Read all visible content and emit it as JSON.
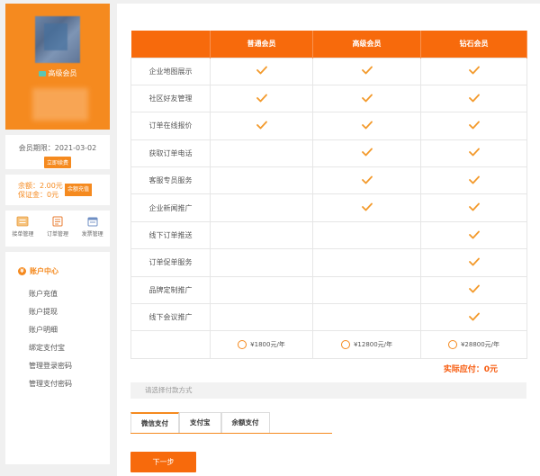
{
  "profile": {
    "level_label": "高级会员",
    "expire_text": "会员期限：2021-03-02",
    "renew_button": "立即续费"
  },
  "balance": {
    "balance_text": "余额：2.00元",
    "deposit_text": "保证金：0元",
    "recharge_button": "余额充值"
  },
  "shortcuts": [
    {
      "label": "接单管理",
      "icon": "clipboard-icon"
    },
    {
      "label": "订单管理",
      "icon": "order-icon"
    },
    {
      "label": "发票管理",
      "icon": "invoice-icon"
    }
  ],
  "account": {
    "title": "账户中心",
    "title_icon": "¥",
    "items": [
      "账户充值",
      "账户提现",
      "账户明细",
      "绑定支付宝",
      "管理登录密码",
      "管理支付密码"
    ]
  },
  "table": {
    "headers": [
      "",
      "普通会员",
      "高级会员",
      "钻石会员"
    ],
    "rows": [
      {
        "feature": "企业地图展示",
        "checks": [
          true,
          true,
          true
        ]
      },
      {
        "feature": "社区好友管理",
        "checks": [
          true,
          true,
          true
        ]
      },
      {
        "feature": "订单在线报价",
        "checks": [
          true,
          true,
          true
        ]
      },
      {
        "feature": "获取订单电话",
        "checks": [
          false,
          true,
          true
        ]
      },
      {
        "feature": "客服专员服务",
        "checks": [
          false,
          true,
          true
        ]
      },
      {
        "feature": "企业新闻推广",
        "checks": [
          false,
          true,
          true
        ]
      },
      {
        "feature": "线下订单推送",
        "checks": [
          false,
          false,
          true
        ]
      },
      {
        "feature": "订单促单服务",
        "checks": [
          false,
          false,
          true
        ]
      },
      {
        "feature": "品牌定制推广",
        "checks": [
          false,
          false,
          true
        ]
      },
      {
        "feature": "线下会议推广",
        "checks": [
          false,
          false,
          true
        ]
      }
    ],
    "prices": [
      "¥1800元/年",
      "¥12800元/年",
      "¥28800元/年"
    ]
  },
  "total_text": "实际应付：0元",
  "payment": {
    "placeholder": "请选择付款方式",
    "tabs": [
      "微信支付",
      "支付宝",
      "余额支付"
    ]
  },
  "next_button": "下一步",
  "colors": {
    "accent": "#f76a0c",
    "accent_light": "#f58a1f"
  }
}
